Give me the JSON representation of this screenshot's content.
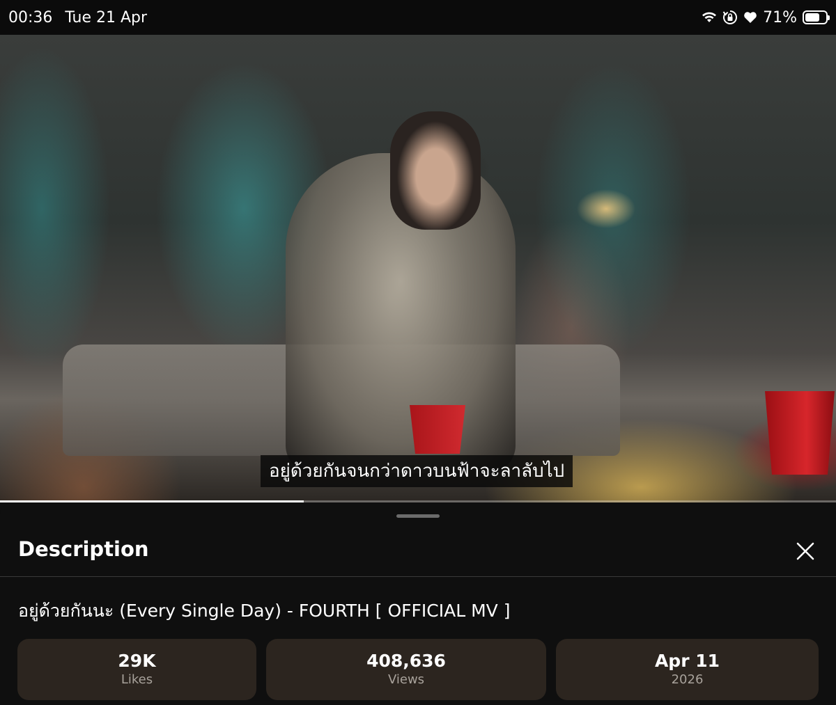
{
  "status_bar": {
    "time": "00:36",
    "date": "Tue 21 Apr",
    "battery_percent": "71%",
    "battery_level": 0.71,
    "icons": [
      "wifi-icon",
      "orientation-lock-icon",
      "heart-icon",
      "battery-icon"
    ]
  },
  "video": {
    "subtitle": "อยู่ด้วยกันจนกว่าดาวบนฟ้าจะลาลับไป",
    "progress_played": 0.363,
    "progress_buffered": 0.363,
    "colors": {
      "accent_cup": "#d7262b"
    }
  },
  "description_panel": {
    "title": "Description",
    "close_icon": "close-icon",
    "video_title": "อยู่ด้วยกันนะ (Every Single Day) - FOURTH [ OFFICIAL MV ]",
    "stats": [
      {
        "value": "29K",
        "label": "Likes"
      },
      {
        "value": "408,636",
        "label": "Views"
      },
      {
        "value": "Apr 11",
        "label": "2026"
      }
    ],
    "colors": {
      "card_bg": "#2c251f",
      "sheet_bg": "#0f0f0f"
    }
  }
}
